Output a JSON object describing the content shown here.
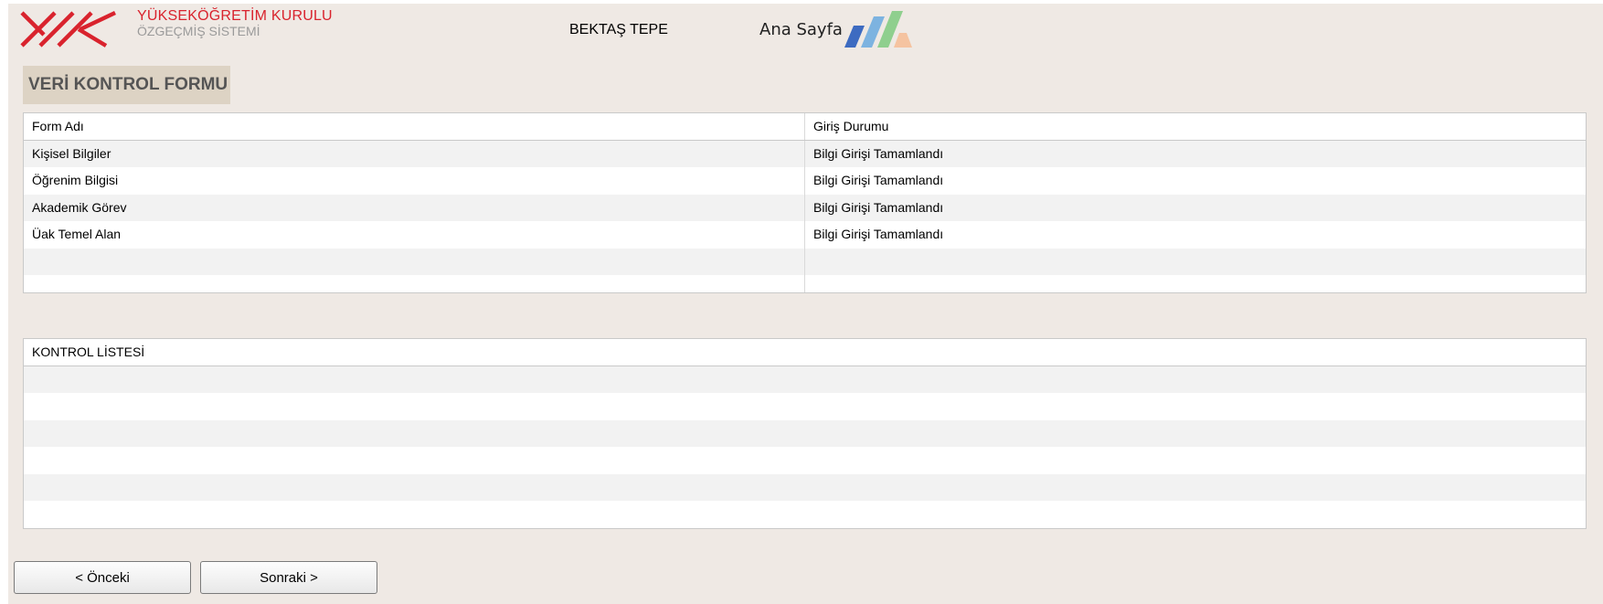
{
  "header": {
    "org_name": "YÜKSEKÖĞRETİM KURULU",
    "system_name": "ÖZGEÇMİŞ SİSTEMİ",
    "user_name": "BEKTAŞ TEPE",
    "home_link": "Ana Sayfa",
    "logo_color": "#d9232d"
  },
  "form_title": "VERİ  KONTROL FORMU",
  "status_table": {
    "columns": [
      "Form Adı",
      "Giriş Durumu"
    ],
    "rows": [
      [
        "Kişisel Bilgiler",
        "Bilgi Girişi Tamamlandı"
      ],
      [
        "Öğrenim Bilgisi",
        "Bilgi Girişi Tamamlandı"
      ],
      [
        "Akademik Görev",
        "Bilgi Girişi Tamamlandı"
      ],
      [
        "Üak Temel Alan",
        "Bilgi Girişi Tamamlandı"
      ]
    ]
  },
  "checklist": {
    "header": "KONTROL LİSTESİ"
  },
  "buttons": {
    "prev": "< Önceki",
    "next": "Sonraki >"
  },
  "graphic_colors": [
    "#3d6bc1",
    "#7db3e0",
    "#8fcf8e",
    "#f5c3a0"
  ]
}
